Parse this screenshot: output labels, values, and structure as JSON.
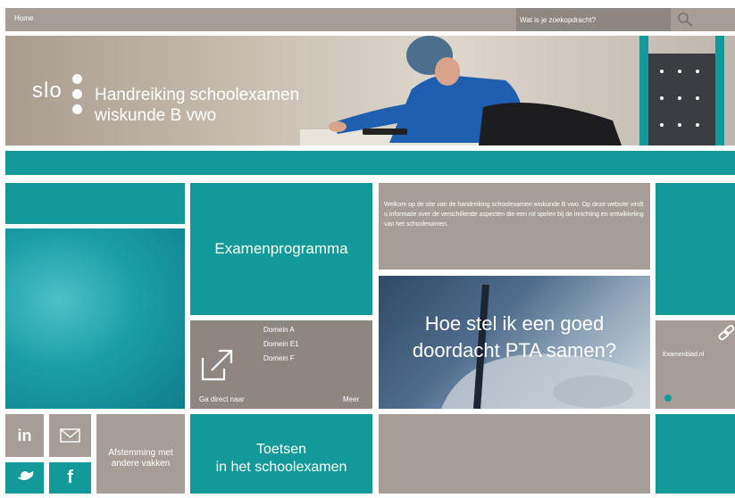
{
  "topbar": {
    "home_label": "Home",
    "search_placeholder": "Wat is je zoekopdracht?"
  },
  "banner": {
    "logo": "slo",
    "title_line1": "Handreiking schoolexamen",
    "title_line2": "wiskunde B vwo"
  },
  "tiles": {
    "examenprogramma": "Examenprogramma",
    "welcome_text": "Welkom op de site van de handreiking schoolexamen wiskunde B vwo. Op deze website vindt u  informatie over de verschillende aspecten die een rol spelen bij de inrichting en ontwikkeling van het schoolexamen.",
    "pta_title": "Hoe stel ik een goed doordacht PTA samen?",
    "ga_direct_naar": "Ga direct naar",
    "domain_links": [
      "Domein A",
      "Domein E1",
      "Domein F"
    ],
    "meer": "Meer",
    "examenblad": "Examenblad.nl",
    "afstemming": "Afstemming met andere vakken",
    "toetsen_line1": "Toetsen",
    "toetsen_line2": "in het schoolexamen"
  },
  "social": {
    "linkedin": "in",
    "facebook": "f"
  },
  "colors": {
    "teal": "#14999a",
    "taupe": "#a69e96",
    "white": "#ffffff"
  }
}
